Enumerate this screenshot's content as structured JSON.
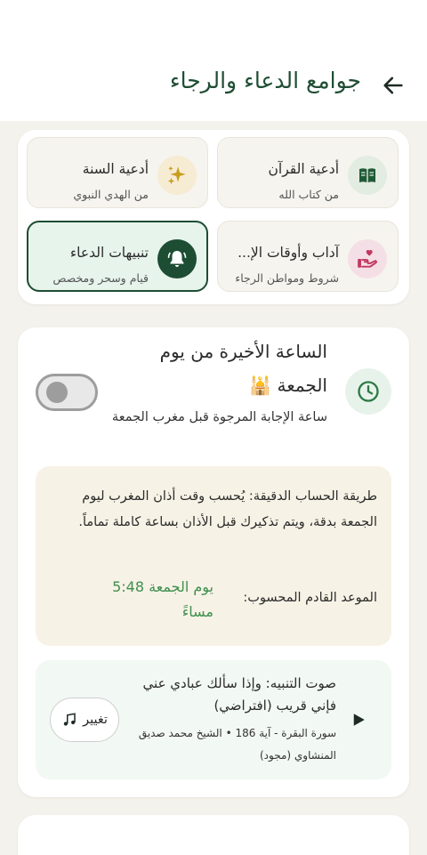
{
  "header": {
    "title": "جوامع الدعاء والرجاء",
    "back_icon": "arrow-back-icon"
  },
  "categories": [
    {
      "title": "أدعية القرآن",
      "subtitle": "من كتاب الله",
      "icon": "book-icon",
      "icon_bg": "#e3ece1",
      "icon_color": "#1f5a36",
      "active": false
    },
    {
      "title": "أدعية السنة",
      "subtitle": "من الهدي النبوي",
      "icon": "sparkles-icon",
      "icon_bg": "#f6ebd3",
      "icon_color": "#c99c1d",
      "active": false
    },
    {
      "title": "آداب وأوقات الإ...",
      "subtitle": "شروط ومواطن الرجاء",
      "icon": "heart-hand-icon",
      "icon_bg": "#f5dfe6",
      "icon_color": "#c2375f",
      "active": false
    },
    {
      "title": "تنبيهات الدعاء",
      "subtitle": "قيام وسحر ومخصص",
      "icon": "bell-icon",
      "icon_bg": "#1d4d33",
      "icon_color": "#ffffff",
      "active": true
    }
  ],
  "friday_alert": {
    "title": "الساعة الأخيرة من يوم الجمعة 🕌",
    "subtitle": "ساعة الإجابة المرجوة قبل مغرب الجمعة",
    "icon": "clock-icon",
    "enabled": false,
    "method_text": "طريقة الحساب الدقيقة: يُحسب وقت أذان المغرب ليوم الجمعة بدقة، ويتم تذكيرك قبل الأذان بساعة كاملة تماماً.",
    "next_label": "الموعد القادم المحسوب:",
    "next_value": "يوم الجمعة 5:48 مساءً"
  },
  "sound": {
    "title": "صوت التنبيه: وإذا سألك عبادي عني فإني قريب (افتراضي)",
    "meta": "سورة البقرة - آية 186 • الشيخ محمد صديق المنشاوي (مجود)",
    "change_label": "تغيير",
    "change_icon": "music-note-icon",
    "play_icon": "play-icon"
  },
  "colors": {
    "primary": "#1d4d33",
    "accent_green": "#3d8f4e",
    "background": "#f4f2ec"
  }
}
